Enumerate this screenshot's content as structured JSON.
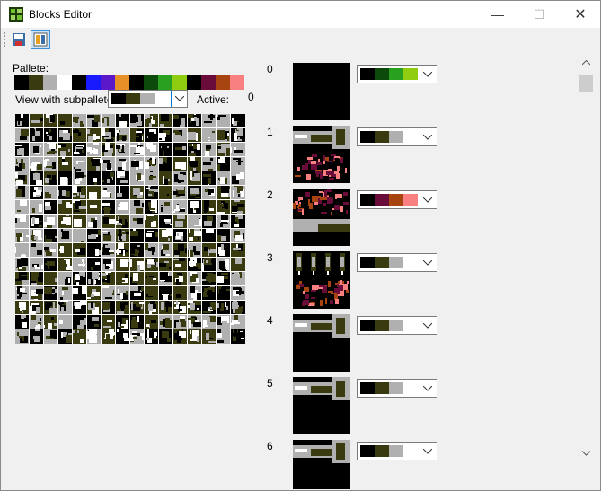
{
  "window": {
    "title": "Blocks Editor",
    "app_icon": "blocks-editor-icon"
  },
  "toolbar": {
    "save_icon": "save-icon",
    "layout_icon": "layout-icon"
  },
  "palette": {
    "label": "Pallete:",
    "colors": [
      "#000000",
      "#3a3a10",
      "#b0b0b0",
      "#ffffff",
      "#000000",
      "#1a1aff",
      "#5a18c8",
      "#e89028",
      "#000000",
      "#0c4a0c",
      "#2aa020",
      "#90cc10",
      "#000000",
      "#6a0c3a",
      "#a84410",
      "#f88080"
    ]
  },
  "subpalette": {
    "label": "View with subpallete:",
    "colors": [
      "#000000",
      "#3a3a10",
      "#b0b0b0",
      "#ffffff"
    ],
    "active_label": "Active:",
    "active_value": "0"
  },
  "blocks": [
    {
      "index": "0",
      "palette": [
        "#000000",
        "#0c4a0c",
        "#2aa020",
        "#90cc10"
      ]
    },
    {
      "index": "1",
      "palette": [
        "#000000",
        "#3a3a10",
        "#b0b0b0",
        "#ffffff"
      ]
    },
    {
      "index": "2",
      "palette": [
        "#000000",
        "#6a0c3a",
        "#a84410",
        "#f88080"
      ]
    },
    {
      "index": "3",
      "palette": [
        "#000000",
        "#3a3a10",
        "#b0b0b0",
        "#ffffff"
      ]
    },
    {
      "index": "4",
      "palette": [
        "#000000",
        "#3a3a10",
        "#b0b0b0",
        "#ffffff"
      ]
    },
    {
      "index": "5",
      "palette": [
        "#000000",
        "#3a3a10",
        "#b0b0b0",
        "#ffffff"
      ]
    },
    {
      "index": "6",
      "palette": [
        "#000000",
        "#3a3a10",
        "#b0b0b0",
        "#ffffff"
      ]
    }
  ]
}
